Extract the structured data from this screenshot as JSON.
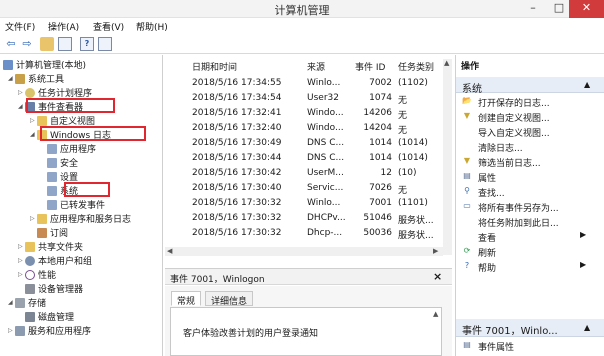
{
  "window": {
    "title": "计算机管理",
    "minimize_glyph": "–",
    "maximize_glyph": "□",
    "close_glyph": "✕"
  },
  "menu": [
    "文件(F)",
    "操作(A)",
    "查看(V)",
    "帮助(H)"
  ],
  "toolbar": {
    "back_glyph": "⇦",
    "forward_glyph": "⇨"
  },
  "tree": [
    {
      "label": "计算机管理(本地)",
      "icon": "computer-icon"
    },
    {
      "label": "系统工具",
      "icon": "tools-icon"
    },
    {
      "label": "任务计划程序",
      "icon": "clock-icon"
    },
    {
      "label": "事件查看器",
      "icon": "event-viewer-icon"
    },
    {
      "label": "自定义视图",
      "icon": "folder-icon"
    },
    {
      "label": "Windows 日志",
      "icon": "log-folder-icon"
    },
    {
      "label": "应用程序",
      "icon": "log-icon"
    },
    {
      "label": "安全",
      "icon": "log-icon"
    },
    {
      "label": "设置",
      "icon": "log-icon"
    },
    {
      "label": "系统",
      "icon": "log-icon"
    },
    {
      "label": "已转发事件",
      "icon": "log-icon"
    },
    {
      "label": "应用程序和服务日志",
      "icon": "folder-icon"
    },
    {
      "label": "订阅",
      "icon": "subscription-icon"
    },
    {
      "label": "共享文件夹",
      "icon": "shared-folder-icon"
    },
    {
      "label": "本地用户和组",
      "icon": "users-icon"
    },
    {
      "label": "性能",
      "icon": "performance-icon"
    },
    {
      "label": "设备管理器",
      "icon": "device-manager-icon"
    },
    {
      "label": "存储",
      "icon": "storage-icon"
    },
    {
      "label": "磁盘管理",
      "icon": "disk-icon"
    },
    {
      "label": "服务和应用程序",
      "icon": "services-icon"
    }
  ],
  "events": {
    "columns": [
      "日期和时间",
      "来源",
      "事件 ID",
      "任务类别"
    ],
    "rows": [
      [
        "2018/5/16 17:34:55",
        "Winlo...",
        "7002",
        "(1102)"
      ],
      [
        "2018/5/16 17:34:54",
        "User32",
        "1074",
        "无"
      ],
      [
        "2018/5/16 17:32:41",
        "Windo...",
        "14206",
        "无"
      ],
      [
        "2018/5/16 17:32:40",
        "Windo...",
        "14204",
        "无"
      ],
      [
        "2018/5/16 17:30:49",
        "DNS C...",
        "1014",
        "(1014)"
      ],
      [
        "2018/5/16 17:30:44",
        "DNS C...",
        "1014",
        "(1014)"
      ],
      [
        "2018/5/16 17:30:42",
        "UserM...",
        "12",
        "(10)"
      ],
      [
        "2018/5/16 17:30:40",
        "Servic...",
        "7026",
        "无"
      ],
      [
        "2018/5/16 17:30:32",
        "Winlo...",
        "7001",
        "(1101)"
      ],
      [
        "2018/5/16 17:30:32",
        "DHCPv...",
        "51046",
        "服务状..."
      ],
      [
        "2018/5/16 17:30:32",
        "Dhcp-...",
        "50036",
        "服务状..."
      ]
    ]
  },
  "event_detail": {
    "title": "事件 7001，Winlogon",
    "close_glyph": "×",
    "tabs": [
      "常规",
      "详细信息"
    ],
    "message": "客户体验改善计划的用户登录通知"
  },
  "actions": {
    "header": "操作",
    "section1": "系统",
    "items1": [
      {
        "label": "打开保存的日志...",
        "icon": "open-log-icon",
        "glyph": "📂",
        "submenu": false
      },
      {
        "label": "创建自定义视图...",
        "icon": "create-view-icon",
        "glyph": "▼",
        "submenu": false
      },
      {
        "label": "导入自定义视图...",
        "icon": "",
        "glyph": "",
        "submenu": false
      },
      {
        "label": "清除日志...",
        "icon": "",
        "glyph": "",
        "submenu": false
      },
      {
        "label": "筛选当前日志...",
        "icon": "filter-icon",
        "glyph": "▼",
        "submenu": false
      },
      {
        "label": "属性",
        "icon": "properties-icon",
        "glyph": "▤",
        "submenu": false
      },
      {
        "label": "查找...",
        "icon": "find-icon",
        "glyph": "⚲",
        "submenu": false
      },
      {
        "label": "将所有事件另存为...",
        "icon": "save-icon",
        "glyph": "▭",
        "submenu": false
      },
      {
        "label": "将任务附加到此日...",
        "icon": "",
        "glyph": "",
        "submenu": false
      },
      {
        "label": "查看",
        "icon": "",
        "glyph": "",
        "submenu": true
      },
      {
        "label": "刷新",
        "icon": "refresh-icon",
        "glyph": "⟳",
        "submenu": false
      },
      {
        "label": "帮助",
        "icon": "help-icon",
        "glyph": "?",
        "submenu": true
      }
    ],
    "section2": "事件 7001，Winlo...",
    "items2": [
      {
        "label": "事件属性",
        "icon": "event-properties-icon",
        "glyph": "▤",
        "submenu": false
      }
    ]
  },
  "colors": {
    "highlight_box": "#e0262e",
    "close_button": "#d23b3b",
    "action_header_bg": "#e7edf6"
  }
}
